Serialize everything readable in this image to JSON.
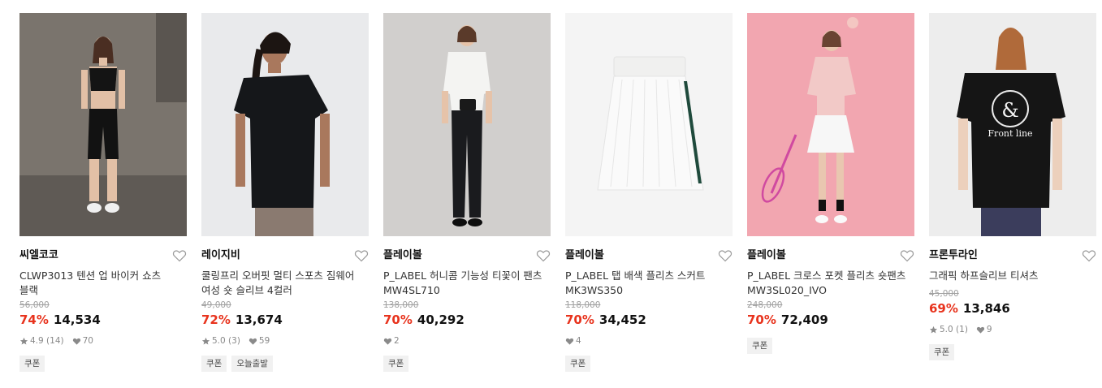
{
  "colors": {
    "discount": "#e8331d",
    "muted": "#a0a0a0",
    "badge_bg": "#f1f1f1"
  },
  "products": [
    {
      "brand": "씨엘코코",
      "name_line1": "CLWP3013 텐션 업 바이커 쇼츠",
      "name_line2": "블랙",
      "original_price": "56,000",
      "discount": "74%",
      "price": "14,534",
      "rating": "4.9",
      "reviews": "(14)",
      "likes": "70",
      "badges": [
        "쿠폰"
      ],
      "image": "woman-sports-bra-biker-shorts"
    },
    {
      "brand": "레이지비",
      "name_line1": "쿨링프리 오버핏 멀티 스포츠 짐웨어",
      "name_line2": "여성 숏 슬리브 4컬러",
      "original_price": "49,000",
      "discount": "72%",
      "price": "13,674",
      "rating": "5.0",
      "reviews": "(3)",
      "likes": "59",
      "badges": [
        "쿠폰",
        "오늘출발"
      ],
      "image": "woman-black-oversized-tee"
    },
    {
      "brand": "플레이볼",
      "name_line1": "P_LABEL 허니콤 기능성 티꽃이 팬츠",
      "name_line2": "MW4SL710",
      "original_price": "138,000",
      "discount": "70%",
      "price": "40,292",
      "rating": "",
      "reviews": "",
      "likes": "2",
      "badges": [
        "쿠폰"
      ],
      "image": "woman-white-polo-black-pants"
    },
    {
      "brand": "플레이볼",
      "name_line1": "P_LABEL 탭 배색 플리츠 스커트",
      "name_line2": "MK3WS350",
      "original_price": "118,000",
      "discount": "70%",
      "price": "34,452",
      "rating": "",
      "reviews": "",
      "likes": "4",
      "badges": [
        "쿠폰"
      ],
      "image": "white-pleated-skirt"
    },
    {
      "brand": "플레이볼",
      "name_line1": "P_LABEL 크로스 포켓 플리츠 숏팬츠",
      "name_line2": "MW3SL020_IVO",
      "original_price": "248,000",
      "discount": "70%",
      "price": "72,409",
      "rating": "",
      "reviews": "",
      "likes": "",
      "badges": [
        "쿠폰"
      ],
      "image": "woman-tennis-pink-background"
    },
    {
      "brand": "프론투라인",
      "name_line1": "그래픽 하프슬리브 티셔츠",
      "name_line2": "",
      "original_price": "45,000",
      "discount": "69%",
      "price": "13,846",
      "rating": "5.0",
      "reviews": "(1)",
      "likes": "9",
      "badges": [
        "쿠폰"
      ],
      "image": "woman-black-graphic-tee",
      "graphic_text": "Front line"
    }
  ]
}
